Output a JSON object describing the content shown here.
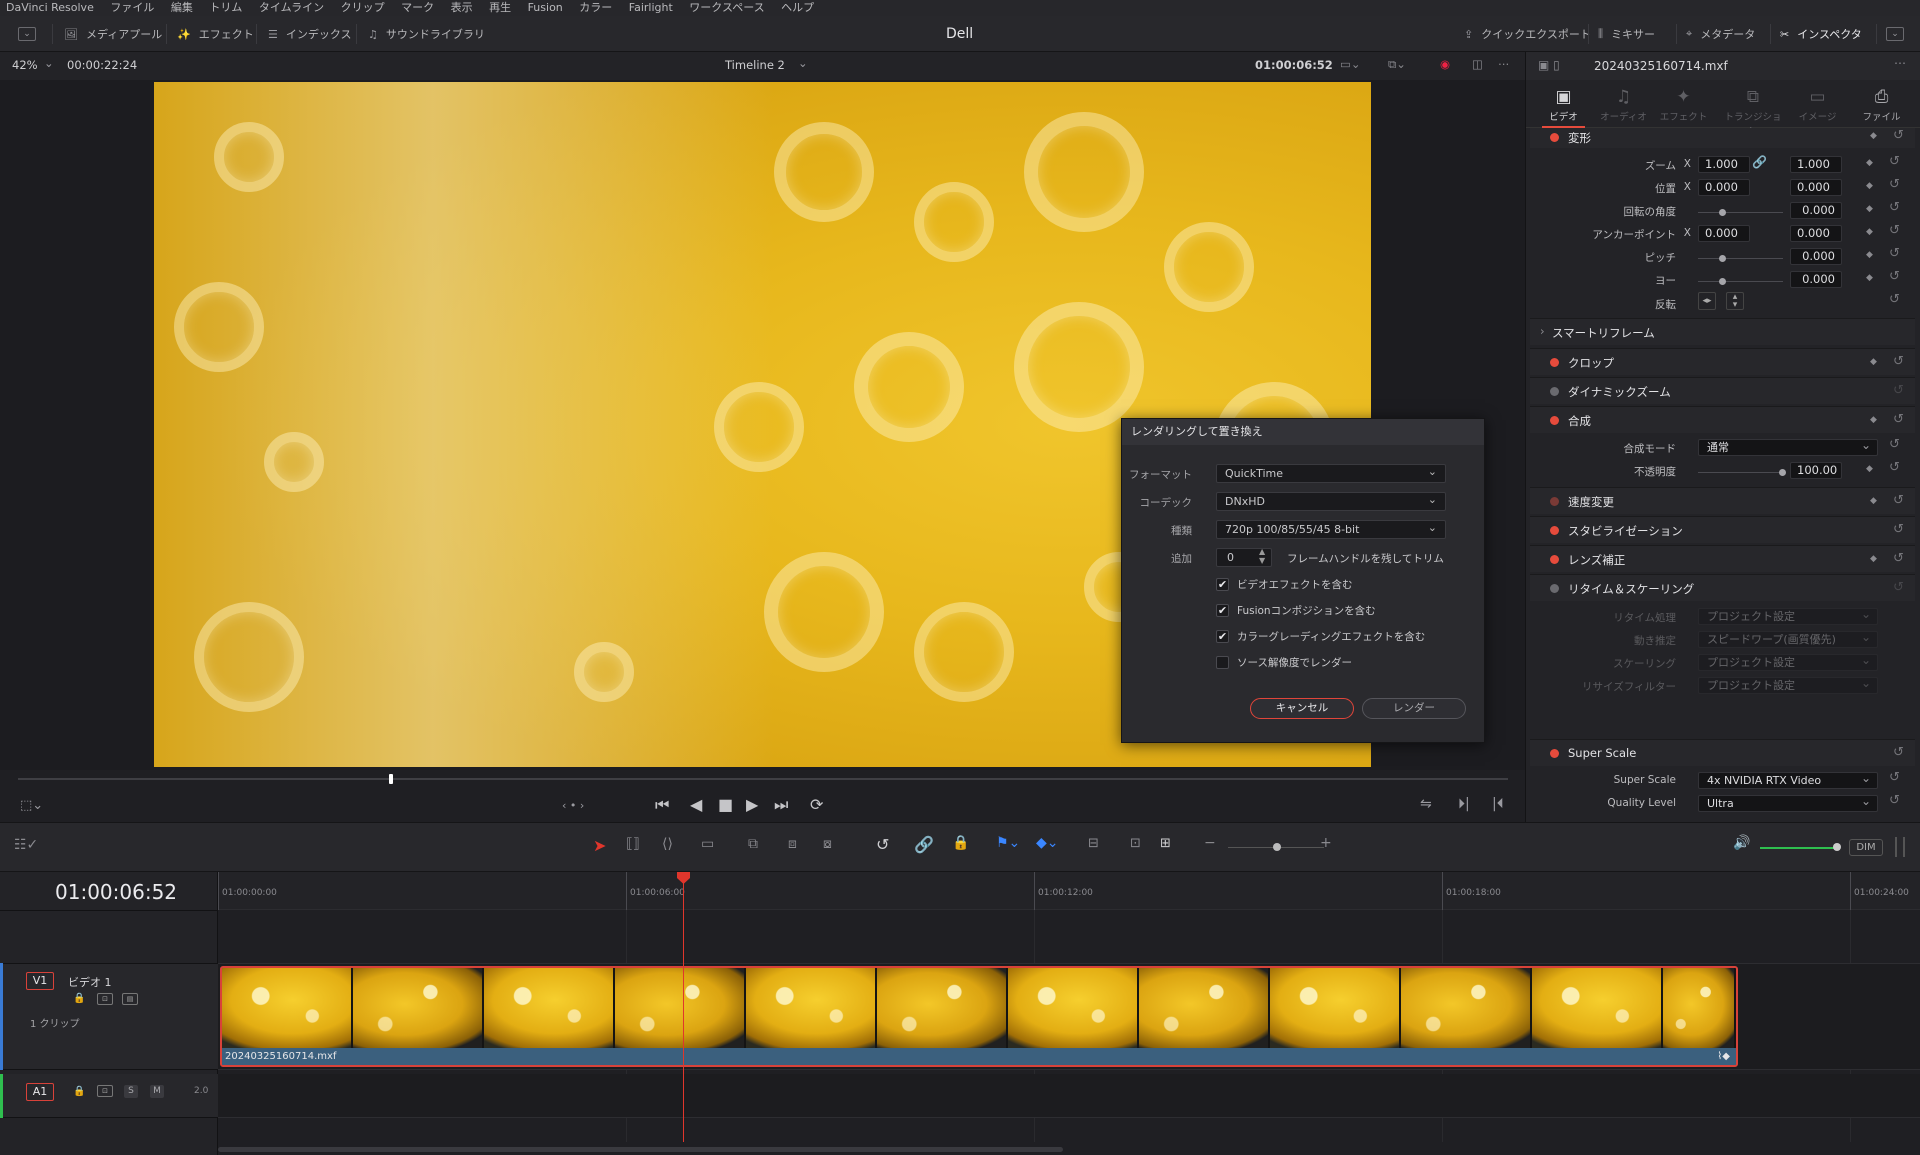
{
  "menu": [
    "DaVinci Resolve",
    "ファイル",
    "編集",
    "トリム",
    "タイムライン",
    "クリップ",
    "マーク",
    "表示",
    "再生",
    "Fusion",
    "カラー",
    "Fairlight",
    "ワークスペース",
    "ヘルプ"
  ],
  "toolbar": {
    "media_pool": "メディアプール",
    "effects": "エフェクト",
    "index": "インデックス",
    "sound_library": "サウンドライブラリ",
    "project_name": "Dell",
    "quick_export": "クイックエクスポート",
    "mixer": "ミキサー",
    "metadata": "メタデータ",
    "inspector": "インスペクタ"
  },
  "viewer": {
    "zoom": "42%",
    "duration": "00:00:22:24",
    "timeline_name": "Timeline 2",
    "timecode": "01:00:06:52",
    "scrub_fraction": 0.25
  },
  "inspector": {
    "clip_name": "20240325160714.mxf",
    "tabs": [
      {
        "label": "ビデオ",
        "icon": "video-icon",
        "glyph": "▣"
      },
      {
        "label": "オーディオ",
        "icon": "audio-icon",
        "glyph": "♫"
      },
      {
        "label": "エフェクト",
        "icon": "effects-icon",
        "glyph": "✦"
      },
      {
        "label": "トランジション",
        "icon": "transition-icon",
        "glyph": "⧉"
      },
      {
        "label": "イメージ",
        "icon": "image-icon",
        "glyph": "▭"
      },
      {
        "label": "ファイル",
        "icon": "file-icon",
        "glyph": "⎙"
      }
    ],
    "transform": {
      "title": "変形",
      "zoom_label": "ズーム",
      "zoom_x": "1.000",
      "zoom_y": "1.000",
      "position_label": "位置",
      "position_x": "0.000",
      "position_y": "0.000",
      "rotation_label": "回転の角度",
      "rotation": "0.000",
      "anchor_label": "アンカーポイント",
      "anchor_x": "0.000",
      "anchor_y": "0.000",
      "pitch_label": "ピッチ",
      "pitch": "0.000",
      "yaw_label": "ヨー",
      "yaw": "0.000",
      "flip_label": "反転",
      "x": "X",
      "y": "Y"
    },
    "smart_reframe": "スマートリフレーム",
    "crop": "クロップ",
    "dynamic_zoom": "ダイナミックズーム",
    "composite": {
      "title": "合成",
      "mode_label": "合成モード",
      "mode": "通常",
      "opacity_label": "不透明度",
      "opacity": "100.00"
    },
    "speed_change": "速度変更",
    "stabilization": "スタビライゼーション",
    "lens_correction": "レンズ補正",
    "retime": {
      "title": "リタイム＆スケーリング",
      "process_label": "リタイム処理",
      "process": "プロジェクト設定",
      "motion_label": "動き推定",
      "motion": "スピードワープ(画質優先)",
      "scaling_label": "スケーリング",
      "scaling": "プロジェクト設定",
      "resize_label": "リサイズフィルター",
      "resize": "プロジェクト設定"
    },
    "super_scale": {
      "title": "Super Scale",
      "scale_label": "Super Scale",
      "scale": "4x NVIDIA RTX Video",
      "quality_label": "Quality Level",
      "quality": "Ultra"
    }
  },
  "dialog": {
    "title": "レンダリングして置き換え",
    "format_label": "フォーマット",
    "format": "QuickTime",
    "codec_label": "コーデック",
    "codec": "DNxHD",
    "type_label": "種類",
    "type": "720p 100/85/55/45 8-bit",
    "add_label": "追加",
    "add_value": "0",
    "add_suffix": "フレームハンドルを残してトリム",
    "options": [
      {
        "label": "ビデオエフェクトを含む",
        "checked": "✔"
      },
      {
        "label": "Fusionコンポジションを含む",
        "checked": "✔"
      },
      {
        "label": "カラーグレーディングエフェクトを含む",
        "checked": "✔"
      },
      {
        "label": "ソース解像度でレンダー",
        "checked": ""
      }
    ],
    "cancel": "キャンセル",
    "render": "レンダー"
  },
  "timeline": {
    "timecode": "01:00:06:52",
    "ruler": [
      "01:00:00:00",
      "01:00:06:00",
      "01:00:12:00",
      "01:00:18:00",
      "01:00:24:00"
    ],
    "v1": {
      "tag": "V1",
      "name": "ビデオ 1",
      "clips": "1 クリップ"
    },
    "a1": {
      "tag": "A1",
      "s": "S",
      "m": "M",
      "level": "2.0"
    },
    "clip_name": "20240325160714.mxf",
    "dim": "DIM"
  },
  "colors": {
    "accent": "#e64b3c",
    "clip": "#3b607e",
    "video_yellow": "#eab91c"
  }
}
